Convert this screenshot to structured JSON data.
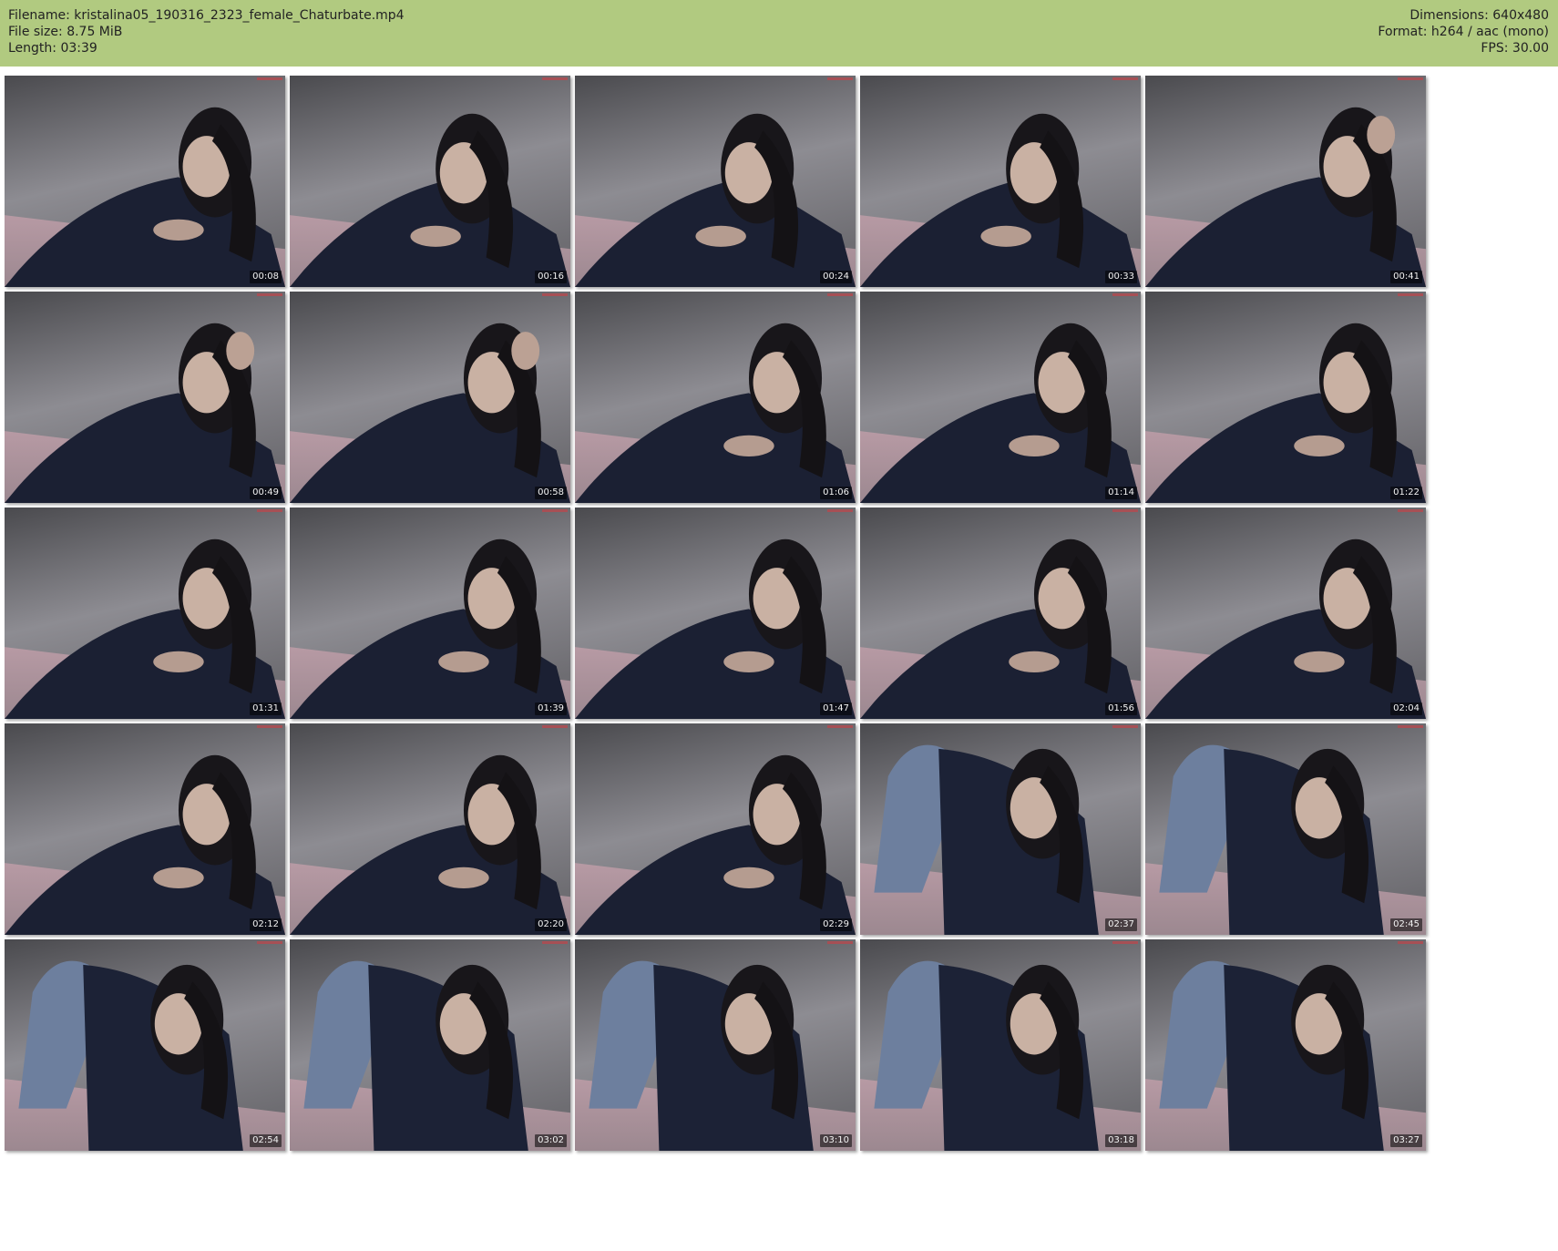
{
  "header": {
    "filename": "Filename: kristalina05_190316_2323_female_Chaturbate.mp4",
    "filesize": "File size: 8.75 MiB",
    "length": "Length: 03:39",
    "dimensions": "Dimensions: 640x480",
    "format": "Format: h264 / aac (mono)",
    "fps": "FPS: 30.00",
    "background": "#b1ca80"
  },
  "grid": {
    "columns": 5,
    "rows": 5
  },
  "thumbnails": [
    {
      "time": "00:08",
      "scene": "lying"
    },
    {
      "time": "00:16",
      "scene": "lying-down"
    },
    {
      "time": "00:24",
      "scene": "lying-down"
    },
    {
      "time": "00:33",
      "scene": "lying-down"
    },
    {
      "time": "00:41",
      "scene": "hand-on-head"
    },
    {
      "time": "00:49",
      "scene": "hand-on-head"
    },
    {
      "time": "00:58",
      "scene": "hand-on-head"
    },
    {
      "time": "01:06",
      "scene": "lying"
    },
    {
      "time": "01:14",
      "scene": "lying"
    },
    {
      "time": "01:22",
      "scene": "lying"
    },
    {
      "time": "01:31",
      "scene": "lying"
    },
    {
      "time": "01:39",
      "scene": "lying"
    },
    {
      "time": "01:47",
      "scene": "lying"
    },
    {
      "time": "01:56",
      "scene": "lying"
    },
    {
      "time": "02:04",
      "scene": "lying"
    },
    {
      "time": "02:12",
      "scene": "lying"
    },
    {
      "time": "02:20",
      "scene": "lying"
    },
    {
      "time": "02:29",
      "scene": "lying"
    },
    {
      "time": "02:37",
      "scene": "kneeling"
    },
    {
      "time": "02:45",
      "scene": "kneeling"
    },
    {
      "time": "02:54",
      "scene": "kneeling"
    },
    {
      "time": "03:02",
      "scene": "kneeling"
    },
    {
      "time": "03:10",
      "scene": "kneeling"
    },
    {
      "time": "03:18",
      "scene": "kneeling"
    },
    {
      "time": "03:27",
      "scene": "kneeling"
    }
  ]
}
